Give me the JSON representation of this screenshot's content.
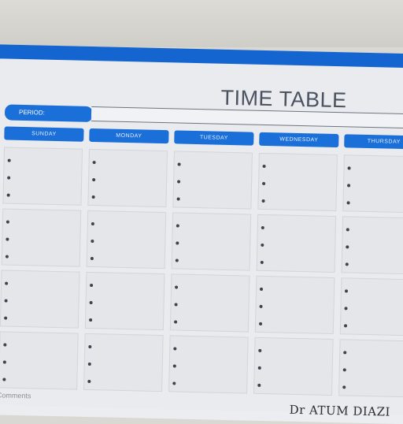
{
  "title": "TIME TABLE",
  "period_label": "PERIOD:",
  "days": [
    "SUNDAY",
    "MONDAY",
    "TUESDAY",
    "WEDNESDAY",
    "THURSDAY"
  ],
  "grid": {
    "rows": 4,
    "bullets_per_cell": 3
  },
  "footer": {
    "left_text": "Comments",
    "right_text": "Dr ATUM DIAZI"
  },
  "colors": {
    "accent": "#1a6fd8",
    "sheet": "#eaebef",
    "text": "#4b5361"
  }
}
